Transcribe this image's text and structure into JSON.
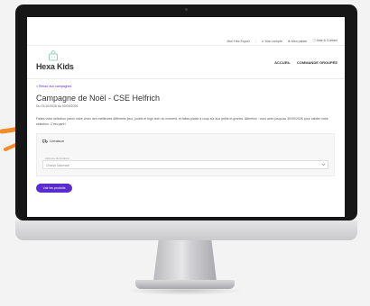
{
  "topbar": {
    "items": [
      "Mon Hex Export",
      "Mon compte",
      "Mon panier",
      "Aide & Contact"
    ]
  },
  "logo": {
    "name": "Hexa Kids",
    "tagline": ""
  },
  "nav": {
    "items": [
      "ACCUEIL",
      "COMMANDE GROUPÉE"
    ]
  },
  "page": {
    "back_link": "< Retour aux campagnes",
    "title": "Campagne de Noël - CSE Helfrich",
    "dates": "Du 01/10/2026 au 30/09/2026",
    "description": "Faites votre sélection parmi notre choix des meilleures différents jeux, jouets et high tech du moment, et faites plaisir à coup sûr aux petits et grands. Attention : vous avez jusqu'au 30/09/2026 pour valider votre sélection. C'est parti !"
  },
  "delivery": {
    "label": "Livraison",
    "field_label": "Adresse de livraison",
    "placeholder": "Choisir l'adresse"
  },
  "actions": {
    "see_products": "Voir les produits"
  },
  "colors": {
    "accent": "#5a2ccf",
    "arrow": "#f28c28",
    "bezel": "#161616"
  },
  "icons": [
    "shopping-bag-icon",
    "user-icon",
    "cart-icon",
    "help-icon",
    "truck-icon",
    "chevron-down-icon",
    "arrow-icon"
  ]
}
